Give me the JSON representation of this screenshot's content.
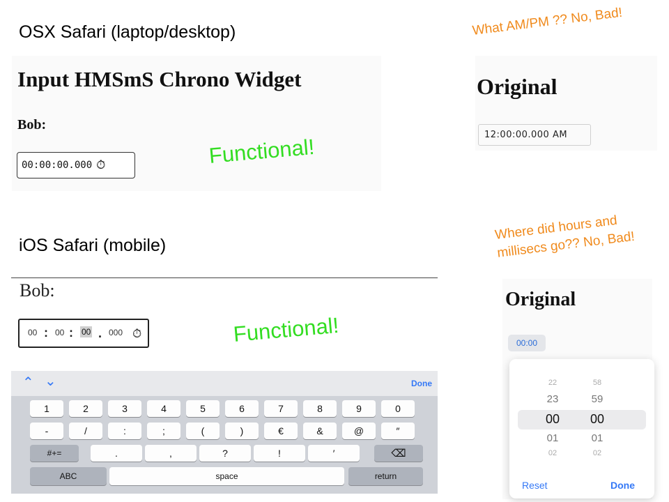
{
  "headings": {
    "osx": "OSX Safari (laptop/desktop)",
    "ios": "iOS Safari (mobile)"
  },
  "notes": {
    "functional_1": "Functional!",
    "functional_2": "Functional!",
    "ampm": "What AM/PM ?? No, Bad!",
    "hours": "Where did hours and millisecs go?? No, Bad!"
  },
  "desktop": {
    "title": "Input HMSmS Chrono Widget",
    "label": "Bob:",
    "value": "00:00:00.000",
    "stopwatch_glyph": "⏱"
  },
  "desktop_original": {
    "title": "Original",
    "value": "12:00:00.000 AM"
  },
  "mobile": {
    "label": "Bob:",
    "segments": [
      "00",
      ":",
      "00",
      ":",
      "00",
      ".",
      "000"
    ],
    "stopwatch_glyph": "⏱",
    "toolbar": {
      "up": "⌃",
      "down": "⌄",
      "done": "Done"
    },
    "keyboard": {
      "row1": [
        "1",
        "2",
        "3",
        "4",
        "5",
        "6",
        "7",
        "8",
        "9",
        "0"
      ],
      "row2": [
        "-",
        "/",
        ":",
        ";",
        "(",
        ")",
        "€",
        "&",
        "@",
        "″"
      ],
      "row3": [
        ".",
        ",",
        "?",
        "!",
        "′"
      ],
      "more_symbols": "#+=",
      "backspace": "⌫",
      "abc": "ABC",
      "space": "space",
      "return": "return"
    }
  },
  "mobile_original": {
    "title": "Original",
    "value": "00:00",
    "hours": [
      "22",
      "23",
      "00",
      "01",
      "02"
    ],
    "minutes": [
      "58",
      "59",
      "00",
      "01",
      "02"
    ],
    "reset": "Reset",
    "done": "Done"
  }
}
